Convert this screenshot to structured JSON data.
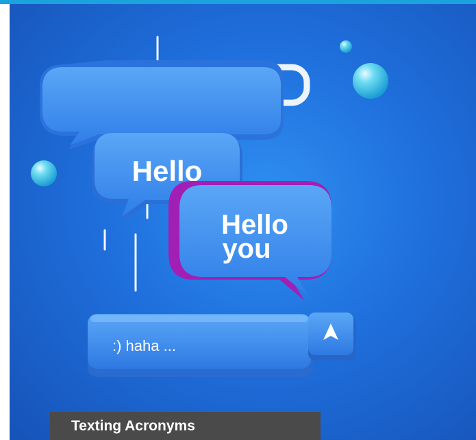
{
  "hero": {
    "bubble_hello": "Hello",
    "bubble_hello_you_line1": "Hello",
    "bubble_hello_you_line2": "you",
    "input_text": ":) haha ...",
    "send_icon": "arrow-up-icon"
  },
  "caption": {
    "title": "Texting Acronyms"
  },
  "colors": {
    "accent": "#1aa3dc",
    "bubble": "#3d8ef0",
    "bubble_dark": "#2a6fd6",
    "magenta": "#a21fb5",
    "caption_bg": "#4a4a4a"
  }
}
